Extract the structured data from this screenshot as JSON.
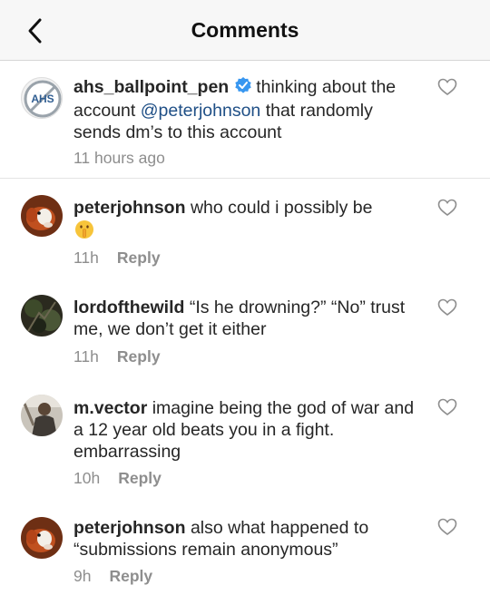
{
  "header": {
    "title": "Comments"
  },
  "comments": [
    {
      "username": "ahs_ballpoint_pen",
      "verified": true,
      "text_before": "thinking about the account ",
      "mention": "@peterjohnson",
      "text_after": " that randomly sends dm’s to this account",
      "time": "11 hours ago",
      "avatar_text": "AHS"
    },
    {
      "username": "peterjohnson",
      "text": "who could i possibly be",
      "emoji": "shushing-face",
      "time": "11h",
      "reply": "Reply"
    },
    {
      "username": "lordofthewild",
      "text": "“Is he drowning?” “No” trust me, we don’t get it either",
      "time": "11h",
      "reply": "Reply"
    },
    {
      "username": "m.vector",
      "text": "imagine being the god of war and a 12 year old beats you in a fight. embarrassing",
      "time": "10h",
      "reply": "Reply"
    },
    {
      "username": "peterjohnson",
      "text": "also what happened to “submissions remain anonymous”",
      "time": "9h",
      "reply": "Reply"
    }
  ],
  "colors": {
    "mention": "#1f4f86",
    "verified": "#3897f0",
    "meta": "#8e8e8e"
  }
}
